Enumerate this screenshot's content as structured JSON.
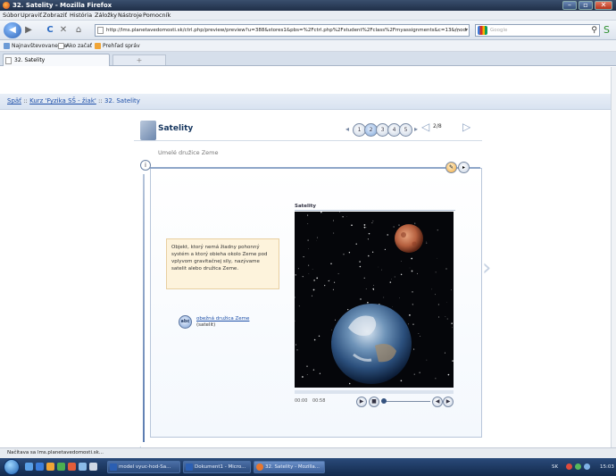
{
  "window": {
    "title": "32. Satelity - Mozilla Firefox",
    "controls": {
      "minimize": "–",
      "maximize": "▫",
      "close": "✕"
    }
  },
  "menu": [
    "Súbor",
    "Upraviť",
    "Zobraziť",
    "História",
    "Záložky",
    "Nástroje",
    "Pomocník"
  ],
  "nav": {
    "back": "◀",
    "forward": "▶",
    "reload": "C",
    "stop": "✕",
    "home": "⌂",
    "url": "http://lms.planetavedomosti.sk/ctrl.php/preview/preview?u=388&stores1&pbs=%2Fctrl.php%2Fstudent%2Fclass%2Fmyassignments&c=13&mod",
    "star": "☆",
    "url_dropdown": "▾",
    "search_placeholder": "Google",
    "search_icon": "⚲",
    "addon_icon": "S"
  },
  "bookmarks": [
    "Najnavštevovanejšie",
    "Ako začať",
    "Prehľad správ"
  ],
  "tabs": {
    "active": "32. Satelity",
    "new_tab": "+"
  },
  "breadcrumb": {
    "back": "Späť",
    "sep1": " :: ",
    "course": "Kurz 'Fyzika SŠ - žiak'",
    "sep2": " :: ",
    "current": "32. Satelity"
  },
  "lesson": {
    "title": "Satelity",
    "subtitle": "Umelé družice Zeme",
    "pages": [
      "1",
      "2",
      "3",
      "4",
      "5"
    ],
    "active_page": 2,
    "count": "2/8",
    "prev_arrow": "◁",
    "next_arrow": "▷",
    "pager_left": "◂",
    "pager_right": "▸",
    "info_label": "i",
    "note": "Objekt, ktorý nemá žiadny pohonný systém a ktorý obieha okolo Zeme pod vplyvom gravitačnej sily, nazývame satelit alebo družica Zeme.",
    "glossary_icon": "abc",
    "glossary_link": "obežná družica Zeme",
    "glossary_sub": "(satelit)",
    "media_title": "Satelity",
    "time_current": "00:00",
    "time_total": "00:58",
    "ctrl_play": "▶",
    "ctrl_stop": "■",
    "ctrl_vol_down": "◀",
    "ctrl_vol_up": "▶",
    "tool1": "✎",
    "tool2": "▸"
  },
  "status": "Načítava sa lms.planetavedomosti.sk...",
  "taskbar": {
    "tasks": [
      "model vyuc-hod-Sa...",
      "Dokument1 - Micro...",
      "32. Satelity - Mozilla..."
    ],
    "lang": "SK",
    "clock": "15:03"
  },
  "colors": {
    "accent": "#1d4fa8",
    "title_bar": "#1f2f48",
    "note_bg": "#fdf3dc"
  }
}
